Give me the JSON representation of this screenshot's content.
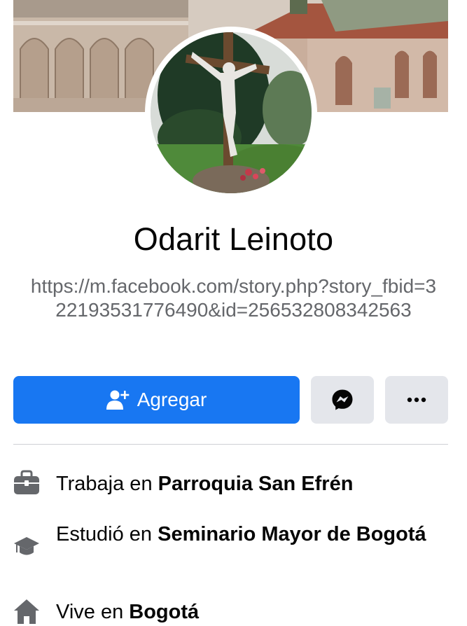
{
  "profile": {
    "name": "Odarit Leinoto",
    "bio": "https://m.facebook.com/story.php?story_fbid=322193531776490&id=256532808342563"
  },
  "actions": {
    "add_label": "Agregar",
    "add_icon": "add-friend-icon",
    "messenger_icon": "messenger-icon",
    "more_icon": "more-icon",
    "primary_color": "#1877f2",
    "secondary_color": "#e4e6eb"
  },
  "details": [
    {
      "icon": "briefcase-icon",
      "prefix": "Trabaja en ",
      "value": "Parroquia San Efrén"
    },
    {
      "icon": "graduation-cap-icon",
      "prefix": "Estudió en ",
      "value": "Seminario Mayor de Bogotá"
    },
    {
      "icon": "home-icon",
      "prefix": "Vive en ",
      "value": "Bogotá"
    }
  ]
}
